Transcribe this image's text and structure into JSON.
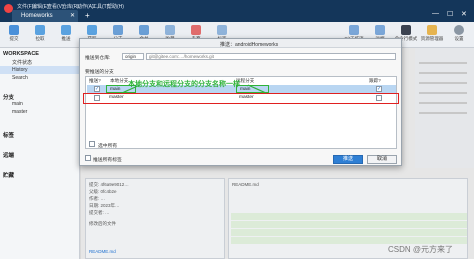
{
  "titlebar": {
    "menu": [
      "文件(F)",
      "编辑(E)",
      "查看(V)",
      "仓库(R)",
      "动作(A)",
      "工具(T)",
      "帮助(H)"
    ],
    "tab_title": "Homeworks",
    "tab_close": "✕",
    "tab_add": "+",
    "window_controls": [
      "—",
      "☐",
      "✕"
    ]
  },
  "toolbar": {
    "buttons": [
      "提交",
      "拉取",
      "推送",
      "获取",
      "分支",
      "合并",
      "贮藏",
      "丢弃",
      "标签"
    ],
    "right_buttons": [
      "Git工作流",
      "远端",
      "命令行模式",
      "资源管理器",
      "设置"
    ]
  },
  "sidebar": {
    "workspace_head": "WORKSPACE",
    "workspace_items": [
      "文件状态",
      "History",
      "Search"
    ],
    "branches_head": "分支",
    "branch_items": [
      "main",
      "master"
    ],
    "tags_head": "标签",
    "remotes_head": "远端",
    "stash_head": "贮藏"
  },
  "dialog": {
    "title": "推送：androidHomeworks",
    "push_to_label": "推送到仓库:",
    "remote_select": "origin",
    "remote_url": "git@gitee.com:…/homeworks.git",
    "branches_label": "要推送的分支",
    "col_push": "推送?",
    "col_local": "本地分支",
    "col_remote": "远程分支",
    "col_track": "跟踪?",
    "rows": [
      {
        "push": true,
        "local": "main",
        "remote": "main",
        "track": true
      },
      {
        "push": false,
        "local": "master",
        "remote": "master",
        "track": false
      }
    ],
    "select_all": "选中所有",
    "push_tags": "推送所有标签",
    "push_button": "推送",
    "cancel_button": "取消",
    "annotation": "本地分支和远程分支的分支名称一样"
  },
  "bottom": {
    "commit_line1": "提交: 4f6a9e9012…",
    "commit_line2": "父级: 0fc4b2e",
    "commit_line3": "作者: …",
    "commit_line4": "日期: 2023年…",
    "commit_line5": "提交者: …",
    "commit_msg": "修改后的文件",
    "file_name": "README.md",
    "right_file": "README.md"
  },
  "watermark": "CSDN @元方来了"
}
